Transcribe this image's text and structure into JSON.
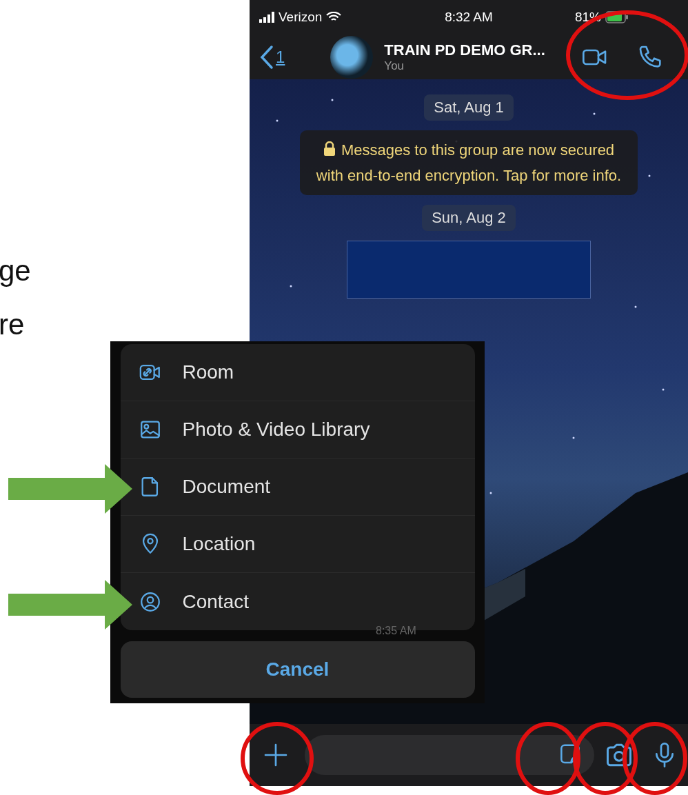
{
  "slide_text": [
    "ge",
    "re"
  ],
  "status_bar": {
    "carrier": "Verizon",
    "time": "8:32 AM",
    "battery": "81%"
  },
  "header": {
    "back_count": "1",
    "title": "TRAIN PD DEMO GR...",
    "subtitle": "You"
  },
  "messages": [
    {
      "kind": "date",
      "text": "Sat, Aug 1"
    },
    {
      "kind": "notice",
      "text": "Messages to this group are now secured with end-to-end encryption. Tap for more info."
    },
    {
      "kind": "date",
      "text": "Sun, Aug 2"
    },
    {
      "kind": "redacted"
    }
  ],
  "timestamp": "8:35 AM",
  "attach_menu": {
    "items": [
      {
        "kind": "room",
        "label": "Room",
        "pointed": false
      },
      {
        "kind": "photo",
        "label": "Photo & Video Library",
        "pointed": false
      },
      {
        "kind": "document",
        "label": "Document",
        "pointed": true
      },
      {
        "kind": "location",
        "label": "Location",
        "pointed": false
      },
      {
        "kind": "contact",
        "label": "Contact",
        "pointed": true
      }
    ],
    "cancel": "Cancel"
  }
}
